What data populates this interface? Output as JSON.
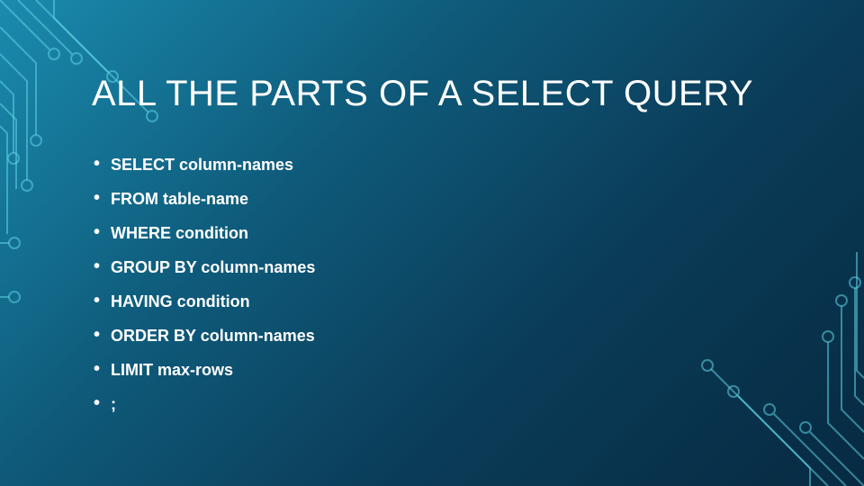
{
  "slide": {
    "title": "ALL THE PARTS OF A SELECT QUERY",
    "bullets": [
      "SELECT column-names",
      "FROM table-name",
      "WHERE condition",
      "GROUP BY column-names",
      "HAVING condition",
      "ORDER BY column-names",
      "LIMIT max-rows",
      ";"
    ]
  }
}
